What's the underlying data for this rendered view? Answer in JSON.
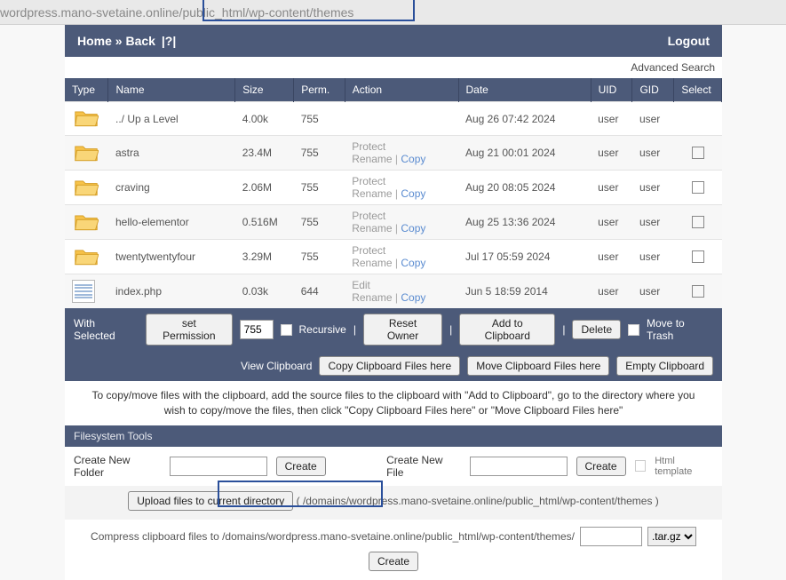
{
  "address_bar": "wordpress.mano-svetaine.online/public_html/wp-content/themes",
  "nav": {
    "home": "Home",
    "back": "Back",
    "q": "|?|",
    "logout": "Logout"
  },
  "adv_search": "Advanced Search",
  "columns": {
    "type": "Type",
    "name": "Name",
    "size": "Size",
    "perm": "Perm.",
    "action": "Action",
    "date": "Date",
    "uid": "UID",
    "gid": "GID",
    "select": "Select"
  },
  "action_labels": {
    "protect": "Protect",
    "rename": "Rename",
    "copy": "Copy",
    "edit": "Edit"
  },
  "rows": [
    {
      "kind": "folder",
      "name": "../ Up a Level",
      "size": "4.00k",
      "perm": "755",
      "action": "none",
      "date": "Aug 26 07:42 2024",
      "uid": "user",
      "gid": "user",
      "sel": false
    },
    {
      "kind": "folder",
      "name": "astra",
      "size": "23.4M",
      "perm": "755",
      "action": "prc",
      "date": "Aug 21 00:01 2024",
      "uid": "user",
      "gid": "user",
      "sel": true
    },
    {
      "kind": "folder",
      "name": "craving",
      "size": "2.06M",
      "perm": "755",
      "action": "prc",
      "date": "Aug 20 08:05 2024",
      "uid": "user",
      "gid": "user",
      "sel": true
    },
    {
      "kind": "folder",
      "name": "hello-elementor",
      "size": "0.516M",
      "perm": "755",
      "action": "prc",
      "date": "Aug 25 13:36 2024",
      "uid": "user",
      "gid": "user",
      "sel": true
    },
    {
      "kind": "folder",
      "name": "twentytwentyfour",
      "size": "3.29M",
      "perm": "755",
      "action": "prc",
      "date": "Jul 17 05:59 2024",
      "uid": "user",
      "gid": "user",
      "sel": true
    },
    {
      "kind": "file",
      "name": "index.php",
      "size": "0.03k",
      "perm": "644",
      "action": "erc",
      "date": "Jun 5 18:59 2014",
      "uid": "user",
      "gid": "user",
      "sel": true
    }
  ],
  "toolbar1": {
    "with_selected": "With Selected",
    "set_permission": "set Permission",
    "perm_value": "755",
    "recursive": "Recursive",
    "reset_owner": "Reset Owner",
    "add_clipboard": "Add to Clipboard",
    "delete": "Delete",
    "move_trash": "Move to Trash"
  },
  "toolbar2": {
    "view_clipboard": "View Clipboard",
    "copy_here": "Copy Clipboard Files here",
    "move_here": "Move Clipboard Files here",
    "empty": "Empty Clipboard"
  },
  "hint": "To copy/move files with the clipboard, add the source files to the clipboard with \"Add to Clipboard\", go to the directory where you wish to copy/move the files, then click \"Copy Clipboard Files here\" or \"Move Clipboard Files here\"",
  "tools_head": "Filesystem Tools",
  "tools": {
    "create_folder": "Create New Folder",
    "create_file": "Create New File",
    "create": "Create",
    "html_template": "Html template",
    "upload": "Upload files to current directory",
    "upload_path": "( /domains/wordpress.mano-svetaine.online/public_html/wp-content/themes )",
    "compress_label": "Compress clipboard files to /domains/wordpress.mano-svetaine.online/public_html/wp-content/themes/",
    "archive_ext": ".tar.gz"
  }
}
